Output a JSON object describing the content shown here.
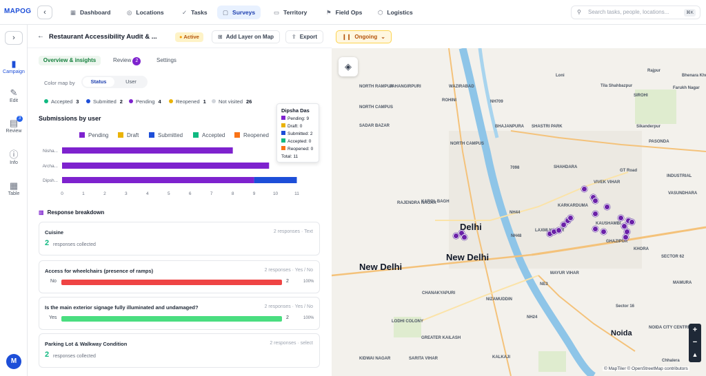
{
  "app": {
    "logo": "MAPOG"
  },
  "nav": [
    {
      "label": "Dashboard",
      "icon": "▦",
      "icon_name": "dashboard-icon"
    },
    {
      "label": "Locations",
      "icon": "◎",
      "icon_name": "location-pin-icon"
    },
    {
      "label": "Tasks",
      "icon": "✓",
      "icon_name": "tasks-icon"
    },
    {
      "label": "Surveys",
      "icon": "▢",
      "icon_name": "clipboard-icon"
    },
    {
      "label": "Territory",
      "icon": "▭",
      "icon_name": "map-icon"
    },
    {
      "label": "Field Ops",
      "icon": "⚑",
      "icon_name": "flag-icon"
    },
    {
      "label": "Logistics",
      "icon": "⬡",
      "icon_name": "box-icon"
    }
  ],
  "search": {
    "placeholder": "Search tasks, people, locations...",
    "shortcut": "⌘K"
  },
  "rail": [
    {
      "label": "Campaign",
      "icon": "▮",
      "icon_name": "campaign-icon"
    },
    {
      "label": "Edit",
      "icon": "✎",
      "icon_name": "edit-icon"
    },
    {
      "label": "Review",
      "icon": "▤",
      "icon_name": "review-icon",
      "badge": "3"
    },
    {
      "label": "Info",
      "icon": "ⓘ",
      "icon_name": "info-icon"
    },
    {
      "label": "Table",
      "icon": "▦",
      "icon_name": "table-icon"
    }
  ],
  "user": {
    "initial": "M"
  },
  "survey": {
    "title": "Restaurant Accessibility Audit & ...",
    "state": "Active",
    "add_layer": "Add Layer on Map",
    "export": "Export",
    "status": "Ongoing"
  },
  "tabs": {
    "overview": "Overview & insights",
    "review": "Review",
    "review_count": "2",
    "settings": "Settings"
  },
  "colormap": {
    "label": "Color map by",
    "status": "Status",
    "user": "User"
  },
  "status_counts": [
    {
      "label": "Accepted",
      "count": "3",
      "color": "#10b981"
    },
    {
      "label": "Submitted",
      "count": "2",
      "color": "#1d4ed8"
    },
    {
      "label": "Pending",
      "count": "4",
      "color": "#7e22ce"
    },
    {
      "label": "Reopened",
      "count": "1",
      "color": "#eab308"
    },
    {
      "label": "Not visited",
      "count": "26",
      "color": "#d1d5db"
    }
  ],
  "chart_title": "Submissions by user",
  "chart_data": {
    "type": "bar",
    "orientation": "horizontal",
    "stacked": true,
    "categories": [
      "Nisha...",
      "Archa...",
      "Dipsh..."
    ],
    "legend": [
      "Pending",
      "Draft",
      "Submitted",
      "Accepted",
      "Reopened"
    ],
    "series": [
      {
        "name": "Pending",
        "color": "#7e22ce",
        "values": [
          8,
          9.7,
          9
        ]
      },
      {
        "name": "Draft",
        "color": "#eab308",
        "values": [
          0,
          0,
          0
        ]
      },
      {
        "name": "Submitted",
        "color": "#1d4ed8",
        "values": [
          0,
          0,
          2
        ]
      },
      {
        "name": "Accepted",
        "color": "#10b981",
        "values": [
          0,
          0,
          0
        ]
      },
      {
        "name": "Reopened",
        "color": "#f97316",
        "values": [
          0,
          0,
          0
        ]
      }
    ],
    "xticks": [
      "0",
      "1",
      "2",
      "3",
      "4",
      "5",
      "6",
      "7",
      "8",
      "9",
      "10",
      "11"
    ],
    "xlim": [
      0,
      11.5
    ]
  },
  "tooltip": {
    "name": "Dipsha Das",
    "rows": [
      {
        "text": "Pending: 9",
        "color": "#7e22ce"
      },
      {
        "text": "Draft: 0",
        "color": "#eab308"
      },
      {
        "text": "Submitted: 2",
        "color": "#1d4ed8"
      },
      {
        "text": "Accepted: 0",
        "color": "#10b981"
      },
      {
        "text": "Reopened: 0",
        "color": "#f97316"
      }
    ],
    "total": "Total: 11"
  },
  "breakdown_title": "Response breakdown",
  "questions": [
    {
      "title": "Cuisine",
      "meta": "2 responses · Text",
      "count": "2",
      "note": "responses collected"
    },
    {
      "title": "Access for wheelchairs (presence of ramps)",
      "meta": "2 responses · Yes / No",
      "bar_label": "No",
      "bar_count": "2",
      "bar_pct": "100%",
      "bar_color": "#ef4444",
      "fill": 1
    },
    {
      "title": "Is the main exterior signage fully illuminated and undamaged?",
      "meta": "2 responses · Yes / No",
      "bar_label": "Yes",
      "bar_count": "2",
      "bar_pct": "100%",
      "bar_color": "#4ade80",
      "fill": 1
    },
    {
      "title": "Parking Lot & Walkway Condition",
      "meta": "2 responses · select",
      "count": "2",
      "note": "responses collected"
    }
  ],
  "map": {
    "attribution": "© MapTiler © OpenStreetMap contributors",
    "labels": [
      "Loni",
      "Rajpur",
      "Bhenara Khurd",
      "Tila Shahbazpur",
      "Farukh Nagar",
      "NORTH RAMPUR",
      "JAHANGIRPURI",
      "WAZIRABAD",
      "SIROHI",
      "ROHINI",
      "NORTH CAMPUS",
      "SADAR BAZAR",
      "SHASTRI PARK",
      "BHAJANPURA",
      "Sikanderpur",
      "PASONDA",
      "NORTH CAMPUS",
      "SHAHDARA",
      "GT Road",
      "RAJENDRA NAGAR",
      "KAROL BAGH",
      "KARKARDUMA",
      "VIVEK VIHAR",
      "VASUNDHARA",
      "INDUSTRIAL",
      "Delhi",
      "New Delhi",
      "New Delhi",
      "LAXMI NAGAR",
      "KAUSHAMBI",
      "GHAZIPUR",
      "KHORA",
      "SECTOR 62",
      "CHANAKYAPURI",
      "NIZAMUDDIN",
      "LODHI COLONY",
      "MAYUR VIHAR",
      "Sector 16",
      "MAMURA",
      "Noida",
      "NOIDA CITY CENTRE",
      "GREATER KAILASH",
      "KALKAJI",
      "SARITA VIHAR",
      "KIDWAI NAGAR",
      "Chhalera",
      "NH709",
      "NH44",
      "NE3",
      "NH48",
      "NH24",
      "7098"
    ]
  }
}
